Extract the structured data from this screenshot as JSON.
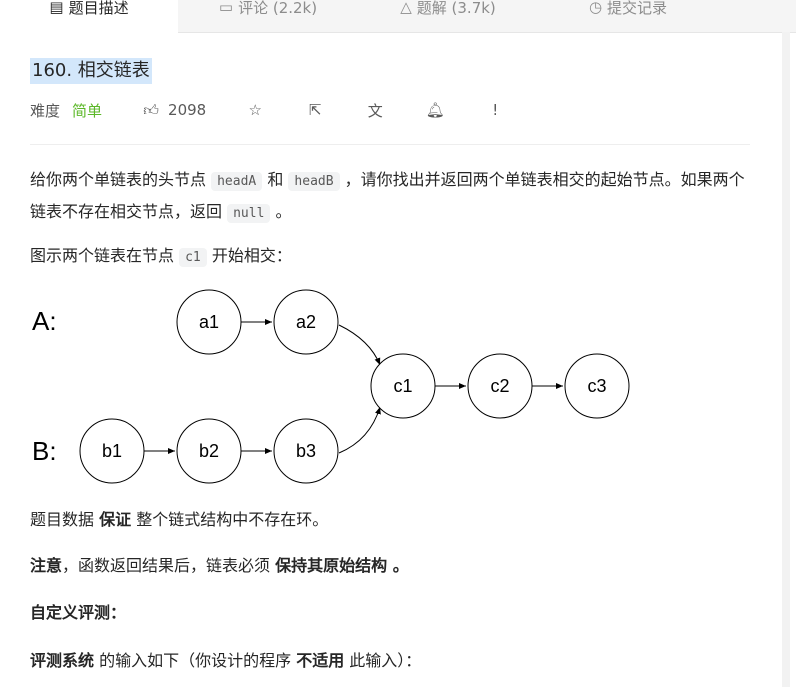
{
  "tabs": [
    {
      "label": "题目描述",
      "icon": "description-icon"
    },
    {
      "label": "评论 (2.2k)",
      "icon": "comment-icon"
    },
    {
      "label": "题解 (3.7k)",
      "icon": "flask-icon"
    },
    {
      "label": "提交记录",
      "icon": "clock-icon"
    }
  ],
  "problem": {
    "title": "160. 相交链表",
    "difficulty_label": "难度",
    "difficulty": "简单",
    "likes": "2098"
  },
  "body": {
    "p1a": "给你两个单链表的头节点 ",
    "c1": "headA",
    "p1b": " 和 ",
    "c2": "headB",
    "p1c": " ，请你找出并返回两个单链表相交的起始节点。如果两个链表不存在相交节点，返回 ",
    "c3": "null",
    "p1d": " 。",
    "p2a": "图示两个链表在节点 ",
    "c4": "c1",
    "p2b": " 开始相交：",
    "p3a": "题目数据 ",
    "p3b": "保证",
    "p3c": " 整个链式结构中不存在环。",
    "p4a": "注意",
    "p4b": "，函数返回结果后，链表必须 ",
    "p4c": "保持其原始结构",
    "p4d": " 。",
    "p5": "自定义评测：",
    "p6a": "评测系统",
    "p6b": " 的输入如下（你设计的程序 ",
    "p6c": "不适用",
    "p6d": " 此输入）："
  },
  "diagram": {
    "labelA": "A:",
    "labelB": "B:",
    "a1": "a1",
    "a2": "a2",
    "b1": "b1",
    "b2": "b2",
    "b3": "b3",
    "c1": "c1",
    "c2": "c2",
    "c3": "c3"
  }
}
